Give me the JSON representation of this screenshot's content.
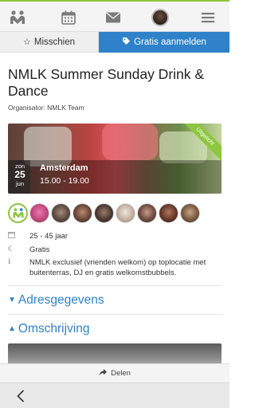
{
  "nav": {
    "icons": [
      "group-icon",
      "calendar-icon",
      "mail-icon",
      "profile-avatar",
      "menu-icon"
    ]
  },
  "tabs": {
    "favorite_label": "Misschien",
    "join_label": "Gratis aanmelden"
  },
  "event": {
    "title": "NMLK Summer Sunday Drink & Dance",
    "organizer": "Organisator: NMLK Team",
    "date": {
      "weekday": "zon",
      "day": "25",
      "month": "jun"
    },
    "city": "Amsterdam",
    "time": "15.00 - 19.00",
    "ribbon": "Uitgelicht"
  },
  "details": {
    "age": "25 - 45 jaar",
    "price": "Gratis",
    "description": "NMLK exclusief (vrienden welkom) op toplocatie met buitenterras, DJ en gratis welkomstbubbels."
  },
  "sections": {
    "address": "Adresgegevens",
    "description": "Omschrijving"
  },
  "share": {
    "label": "Delen"
  },
  "colors": {
    "accent_blue": "#2f82c9",
    "accent_green": "#8dc63f"
  }
}
